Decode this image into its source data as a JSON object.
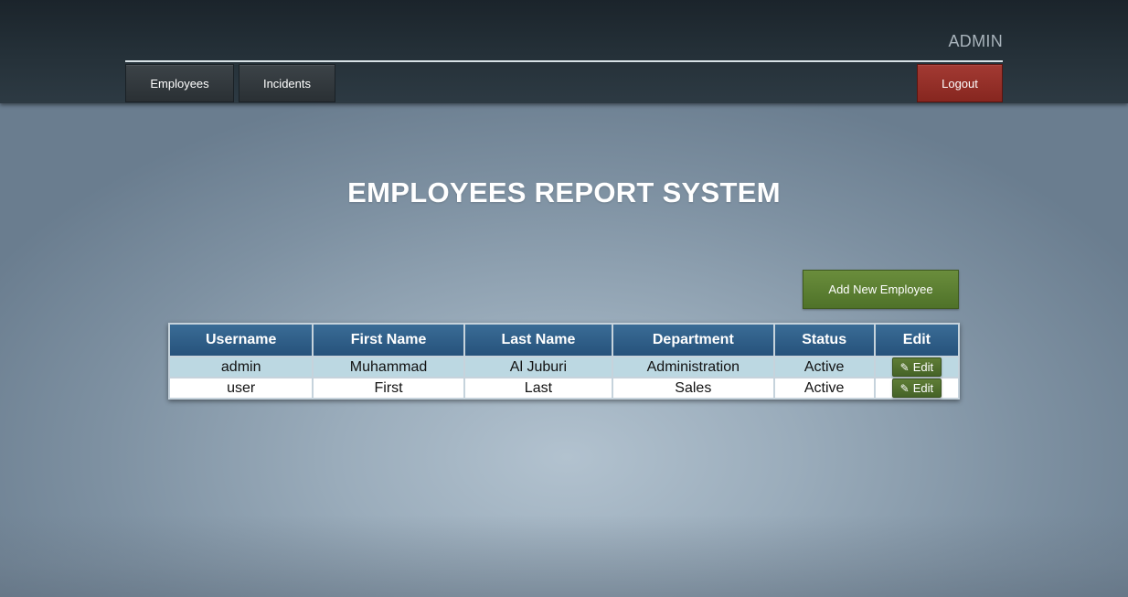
{
  "header": {
    "user_label": "ADMIN",
    "nav": {
      "employees": "Employees",
      "incidents": "Incidents",
      "logout": "Logout"
    }
  },
  "main": {
    "title": "EMPLOYEES REPORT SYSTEM",
    "add_button": "Add New Employee"
  },
  "table": {
    "columns": [
      "Username",
      "First Name",
      "Last Name",
      "Department",
      "Status",
      "Edit"
    ],
    "rows": [
      {
        "username": "admin",
        "first_name": "Muhammad",
        "last_name": "Al Juburi",
        "department": "Administration",
        "status": "Active",
        "edit_label": "Edit"
      },
      {
        "username": "user",
        "first_name": "First",
        "last_name": "Last",
        "department": "Sales",
        "status": "Active",
        "edit_label": "Edit"
      }
    ]
  },
  "icons": {
    "edit": "pencil-icon"
  },
  "colors": {
    "header_bg": "#253139",
    "logout": "#96302a",
    "add_button": "#5c7f32",
    "table_header": "#2f5f89",
    "row_highlight": "#bcd8e2"
  }
}
